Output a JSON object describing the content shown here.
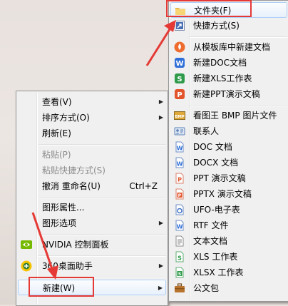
{
  "context_menu": {
    "items": [
      {
        "label": "查看(V)",
        "submenu": true
      },
      {
        "label": "排序方式(O)",
        "submenu": true
      },
      {
        "label": "刷新(E)"
      },
      {
        "label": "粘贴(P)",
        "disabled": true
      },
      {
        "label": "粘贴快捷方式(S)",
        "disabled": true
      },
      {
        "label": "撤消 重命名(U)",
        "shortcut": "Ctrl+Z"
      },
      {
        "label": "图形属性..."
      },
      {
        "label": "图形选项",
        "submenu": true
      },
      {
        "label": "NVIDIA 控制面板",
        "icon": "nvidia-icon"
      },
      {
        "label": "360桌面助手",
        "icon": "360-assistant-icon",
        "submenu": true
      },
      {
        "label": "新建(W)",
        "submenu": true,
        "highlighted": true
      }
    ]
  },
  "new_submenu": {
    "items": [
      {
        "label": "文件夹(F)",
        "icon": "folder-icon",
        "highlighted": true
      },
      {
        "label": "快捷方式(S)",
        "icon": "shortcut-icon"
      },
      {
        "label": "从模板库中新建文档",
        "icon": "template-library-icon"
      },
      {
        "label": "新建DOC文档",
        "icon": "wps-writer-icon"
      },
      {
        "label": "新建XLS工作表",
        "icon": "wps-spreadsheet-icon"
      },
      {
        "label": "新建PPT演示文稿",
        "icon": "wps-presentation-icon"
      },
      {
        "label": "看图王 BMP 图片文件",
        "icon": "bmp-file-icon"
      },
      {
        "label": "联系人",
        "icon": "contact-icon"
      },
      {
        "label": "DOC 文档",
        "icon": "doc-file-icon"
      },
      {
        "label": "DOCX 文档",
        "icon": "docx-file-icon"
      },
      {
        "label": "PPT 演示文稿",
        "icon": "ppt-file-icon"
      },
      {
        "label": "PPTX 演示文稿",
        "icon": "pptx-file-icon"
      },
      {
        "label": "UFO-电子表",
        "icon": "ufo-file-icon"
      },
      {
        "label": "RTF 文件",
        "icon": "rtf-file-icon"
      },
      {
        "label": "文本文档",
        "icon": "text-file-icon"
      },
      {
        "label": "XLS 工作表",
        "icon": "xls-file-icon"
      },
      {
        "label": "XLSX 工作表",
        "icon": "xlsx-file-icon"
      },
      {
        "label": "公文包",
        "icon": "briefcase-icon"
      }
    ]
  },
  "colors": {
    "highlight_border": "#e53935",
    "annotation_arrow": "#e53935"
  }
}
